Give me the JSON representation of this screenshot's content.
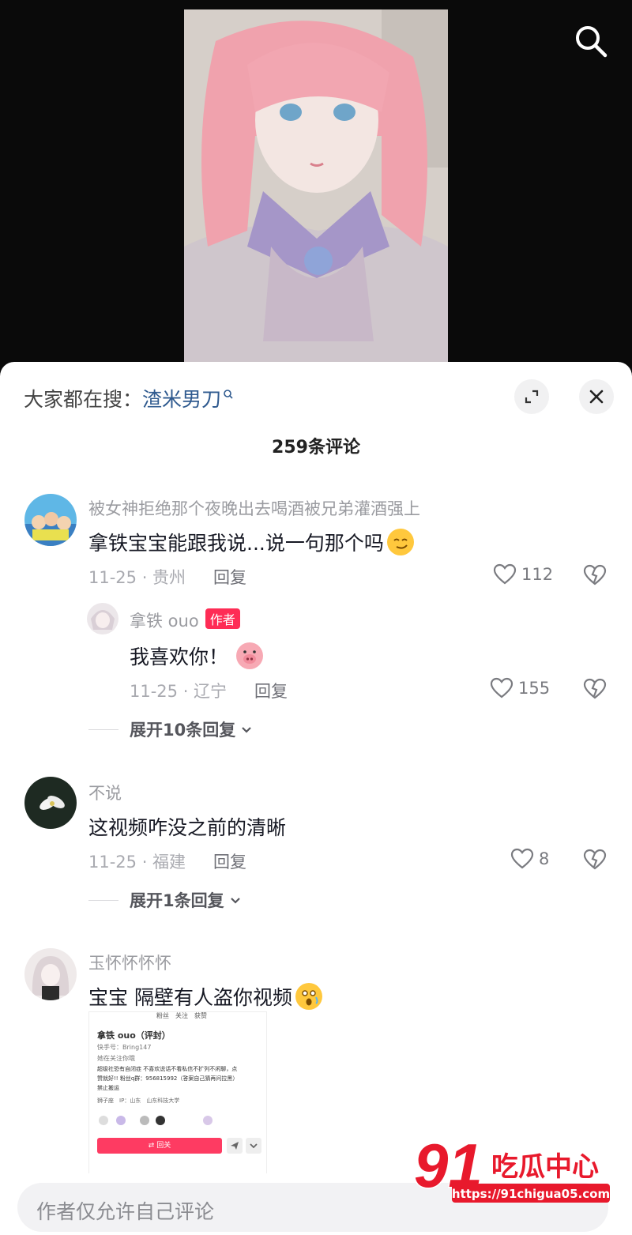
{
  "hot_search": {
    "prefix": "大家都在搜：",
    "term": "渣米男刀"
  },
  "comment_count": "259条评论",
  "comments": [
    {
      "user": "被女神拒绝那个夜晚出去喝酒被兄弟灌酒强上",
      "text": "拿铁宝宝能跟我说...说一句那个吗",
      "date_location": "11-25 · 贵州",
      "reply": "回复",
      "likes": "112",
      "replies": [
        {
          "user": "拿铁 ouo",
          "badge": "作者",
          "text": "我喜欢你！",
          "date_location": "11-25 · 辽宁",
          "reply": "回复",
          "likes": "155"
        }
      ],
      "expand": "展开10条回复"
    },
    {
      "user": "不说",
      "text": "这视频咋没之前的清晰",
      "date_location": "11-25 · 福建",
      "reply": "回复",
      "likes": "8",
      "expand": "展开1条回复"
    },
    {
      "user": "玉怀怀怀怀",
      "text": "宝宝 隔壁有人盗你视频",
      "screenshot": {
        "stats": "粉丝　关注　获赞",
        "name": "拿铁 ouo（评封）",
        "id": "快手号：Bring147",
        "follows_you": "她在关注你哦",
        "bio1": "超级社恐有自闭症 不喜欢说话不看私信不扩列不闲聊，点",
        "bio2": "赞就好!! 粉丝q群：956815992（答案自己猜再问拉黑）",
        "bio3": "禁止搬运",
        "tags": "狮子座　IP：山东　山东科技大学",
        "follow_btn": "⇄ 回关"
      }
    }
  ],
  "input_placeholder": "作者仅允许自己评论",
  "watermark": {
    "logo": "91",
    "name": "吃瓜中心",
    "url": "https://91chigua05.com"
  }
}
